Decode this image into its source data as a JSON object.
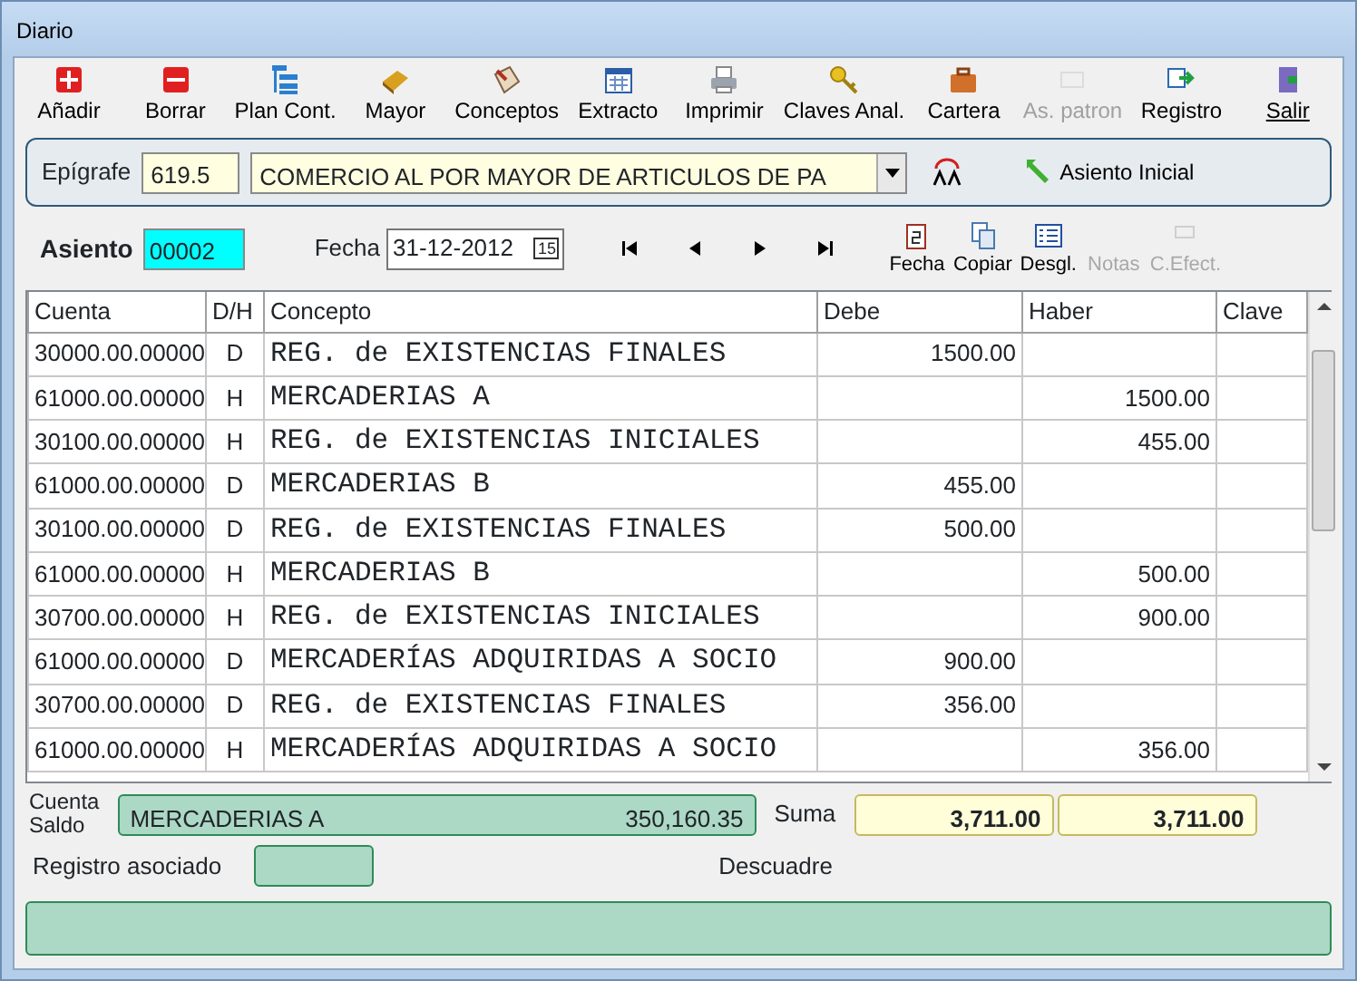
{
  "window": {
    "title": "Diario"
  },
  "toolbar": [
    {
      "label": "Añadir",
      "disabled": false
    },
    {
      "label": "Borrar",
      "disabled": false
    },
    {
      "label": "Plan Cont.",
      "disabled": false
    },
    {
      "label": "Mayor",
      "disabled": false
    },
    {
      "label": "Conceptos",
      "disabled": false
    },
    {
      "label": "Extracto",
      "disabled": false
    },
    {
      "label": "Imprimir",
      "disabled": false
    },
    {
      "label": "Claves Anal.",
      "disabled": false
    },
    {
      "label": "Cartera",
      "disabled": false
    },
    {
      "label": "As. patron",
      "disabled": true
    },
    {
      "label": "Registro",
      "disabled": false
    },
    {
      "label": "Salir",
      "disabled": false
    }
  ],
  "epigrafe": {
    "label": "Epígrafe",
    "code": "619.5",
    "description": "COMERCIO AL POR MAYOR DE ARTICULOS DE PA",
    "asiento_inicial": "Asiento Inicial"
  },
  "asiento": {
    "label": "Asiento",
    "value": "00002",
    "fecha_label": "Fecha",
    "fecha": "31-12-2012",
    "calendar_day": "15"
  },
  "actions": [
    {
      "label": "Fecha",
      "disabled": false
    },
    {
      "label": "Copiar",
      "disabled": false
    },
    {
      "label": "Desgl.",
      "disabled": false
    },
    {
      "label": "Notas",
      "disabled": true
    },
    {
      "label": "C.Efect.",
      "disabled": true
    }
  ],
  "table": {
    "columns": [
      "Cuenta",
      "D/H",
      "Concepto",
      "Debe",
      "Haber",
      "Clave"
    ],
    "rows": [
      [
        "30000.00.00000",
        "D",
        "REG. de EXISTENCIAS FINALES",
        "1500.00",
        "",
        ""
      ],
      [
        "61000.00.00000",
        "H",
        "MERCADERIAS A",
        "",
        "1500.00",
        ""
      ],
      [
        "30100.00.00000",
        "H",
        "REG. de EXISTENCIAS INICIALES",
        "",
        "455.00",
        ""
      ],
      [
        "61000.00.00000",
        "D",
        "MERCADERIAS B",
        "455.00",
        "",
        ""
      ],
      [
        "30100.00.00000",
        "D",
        "REG. de EXISTENCIAS FINALES",
        "500.00",
        "",
        ""
      ],
      [
        "61000.00.00000",
        "H",
        "MERCADERIAS B",
        "",
        "500.00",
        ""
      ],
      [
        "30700.00.00000",
        "H",
        "REG. de EXISTENCIAS INICIALES",
        "",
        "900.00",
        ""
      ],
      [
        "61000.00.00000",
        "D",
        "MERCADERÍAS ADQUIRIDAS A SOCIO",
        "900.00",
        "",
        ""
      ],
      [
        "30700.00.00000",
        "D",
        "REG. de EXISTENCIAS FINALES",
        "356.00",
        "",
        ""
      ],
      [
        "61000.00.00000",
        "H",
        "MERCADERÍAS ADQUIRIDAS A SOCIO",
        "",
        "356.00",
        ""
      ]
    ]
  },
  "footer": {
    "cuenta_label": "Cuenta",
    "saldo_label": "Saldo",
    "cuenta_name": "MERCADERIAS A",
    "saldo": "350,160.35",
    "suma_label": "Suma",
    "suma_debe": "3,711.00",
    "suma_haber": "3,711.00",
    "registro_label": "Registro asociado",
    "descuadre_label": "Descuadre"
  }
}
